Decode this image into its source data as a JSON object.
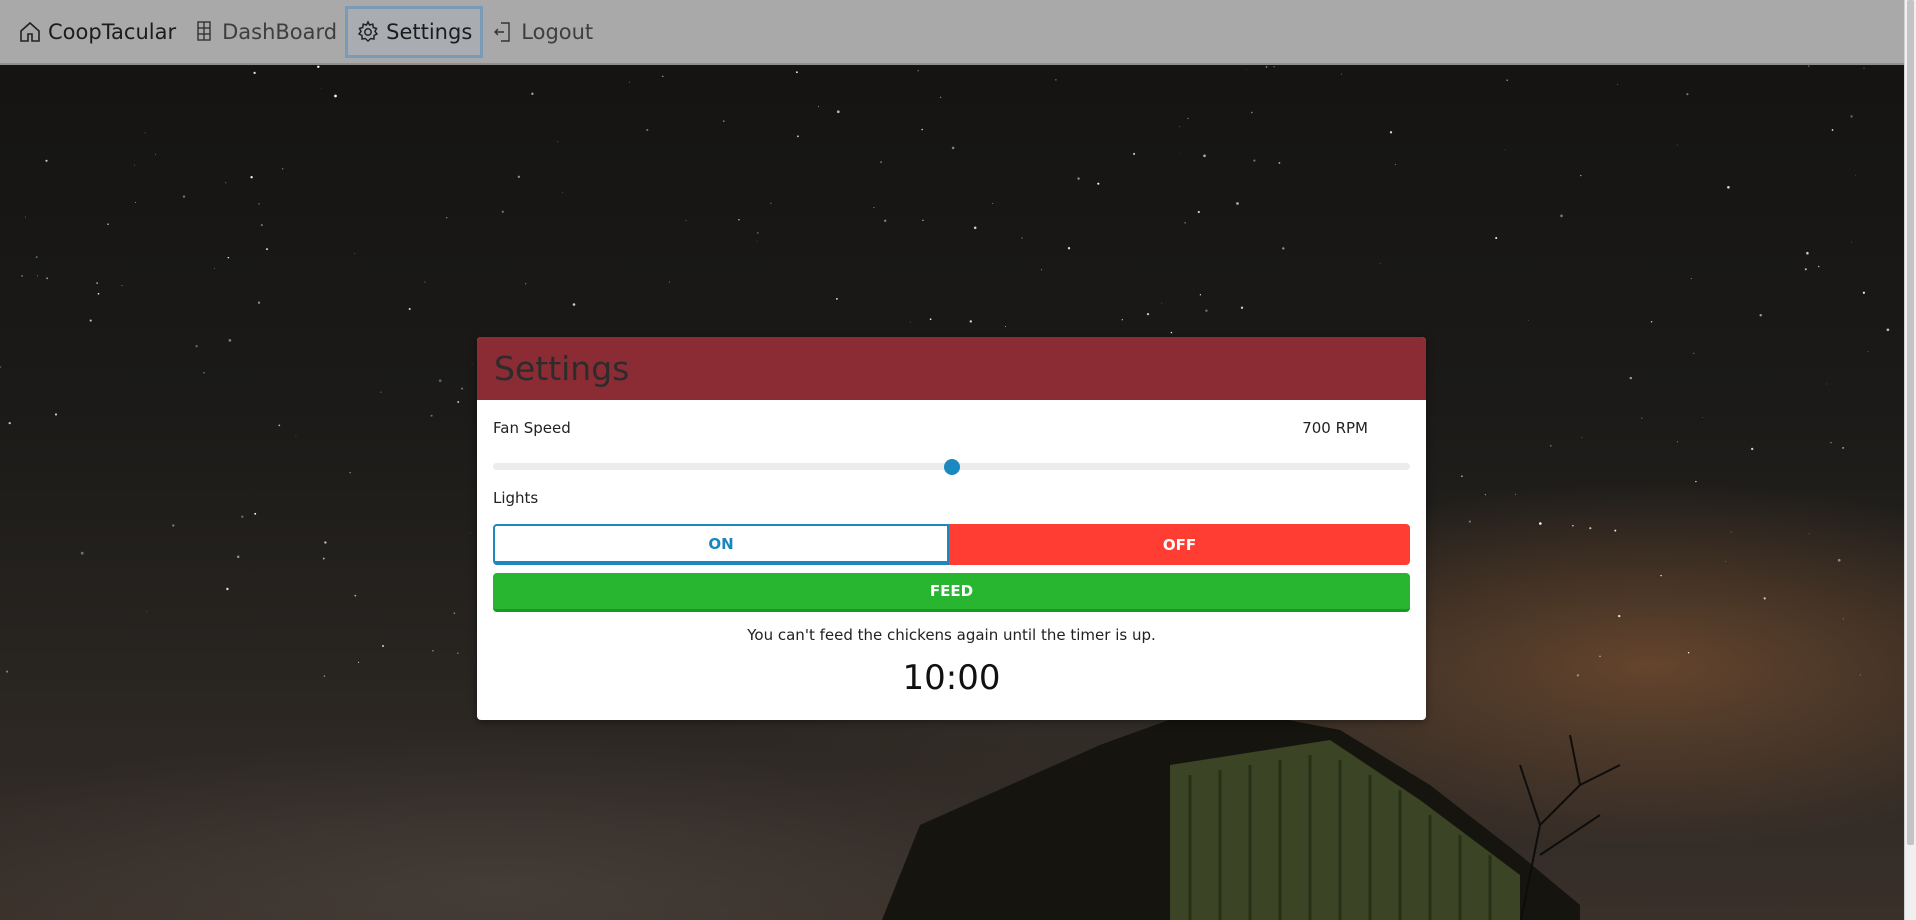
{
  "navbar": {
    "brand": "CoopTacular",
    "brand_icon": "home-icon",
    "items": [
      {
        "label": "DashBoard",
        "icon": "dashboard-icon"
      },
      {
        "label": "Settings",
        "icon": "gear-icon"
      },
      {
        "label": "Logout",
        "icon": "logout-icon"
      }
    ]
  },
  "settings": {
    "title": "Settings",
    "fan_speed_label": "Fan Speed",
    "fan_speed_value": "700 RPM",
    "fan_speed_level": 0.5,
    "lights_label": "Lights",
    "lights_on_label": "ON",
    "lights_off_label": "OFF",
    "lights_state": "OFF",
    "feed_label": "FEED",
    "feed_notice": "You can't feed the chickens again until the timer is up.",
    "timer": "10:00"
  },
  "colors": {
    "header": "#8b2c35",
    "accent_blue": "#1b88c0",
    "off_red": "#ff3d33",
    "feed_green": "#28b631",
    "navbar": "#a9a9a9"
  }
}
